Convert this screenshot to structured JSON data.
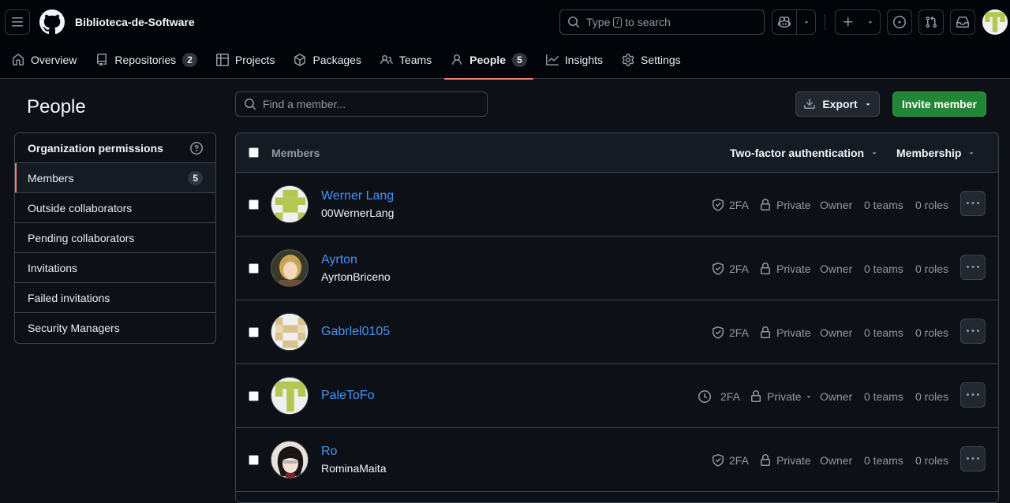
{
  "header": {
    "org_name": "Biblioteca-de-Software",
    "search": {
      "prefix": "Type",
      "key": "/",
      "suffix": "to search"
    }
  },
  "tabs": [
    {
      "label": "Overview",
      "icon": "home-icon"
    },
    {
      "label": "Repositories",
      "icon": "repo-icon",
      "count": "2"
    },
    {
      "label": "Projects",
      "icon": "table-icon"
    },
    {
      "label": "Packages",
      "icon": "package-icon"
    },
    {
      "label": "Teams",
      "icon": "people-icon"
    },
    {
      "label": "People",
      "icon": "person-icon",
      "count": "5",
      "selected": true
    },
    {
      "label": "Insights",
      "icon": "graph-icon"
    },
    {
      "label": "Settings",
      "icon": "gear-icon"
    }
  ],
  "page_title": "People",
  "sidebar": {
    "heading": "Organization permissions",
    "items": [
      {
        "label": "Members",
        "count": "5",
        "active": true
      },
      {
        "label": "Outside collaborators"
      },
      {
        "label": "Pending collaborators"
      },
      {
        "label": "Invitations"
      },
      {
        "label": "Failed invitations"
      },
      {
        "label": "Security Managers"
      }
    ]
  },
  "toolbar": {
    "find_placeholder": "Find a member...",
    "export_label": "Export",
    "invite_label": "Invite member"
  },
  "members_table": {
    "header_label": "Members",
    "filter_2fa": "Two-factor authentication",
    "filter_membership": "Membership",
    "rows": [
      {
        "name": "Werner Lang",
        "login": "00WernerLang",
        "twofa": "2FA",
        "visibility": "Private",
        "role": "Owner",
        "teams": "0 teams",
        "roles": "0 roles"
      },
      {
        "name": "Ayrton",
        "login": "AyrtonBriceno",
        "twofa": "2FA",
        "visibility": "Private",
        "role": "Owner",
        "teams": "0 teams",
        "roles": "0 roles"
      },
      {
        "name": "Gabrlel0105",
        "login": "",
        "twofa": "2FA",
        "visibility": "Private",
        "role": "Owner",
        "teams": "0 teams",
        "roles": "0 roles"
      },
      {
        "name": "PaleToFo",
        "login": "",
        "twofa": "2FA",
        "visibility": "Private",
        "role": "Owner",
        "teams": "0 teams",
        "roles": "0 roles"
      },
      {
        "name": "Ro",
        "login": "RominaMaita",
        "twofa": "2FA",
        "visibility": "Private",
        "role": "Owner",
        "teams": "0 teams",
        "roles": "0 roles"
      }
    ]
  },
  "colors": {
    "accent_tab": "#f78166",
    "link": "#4493f8",
    "primary_button": "#238636",
    "background": "#0d1117"
  }
}
